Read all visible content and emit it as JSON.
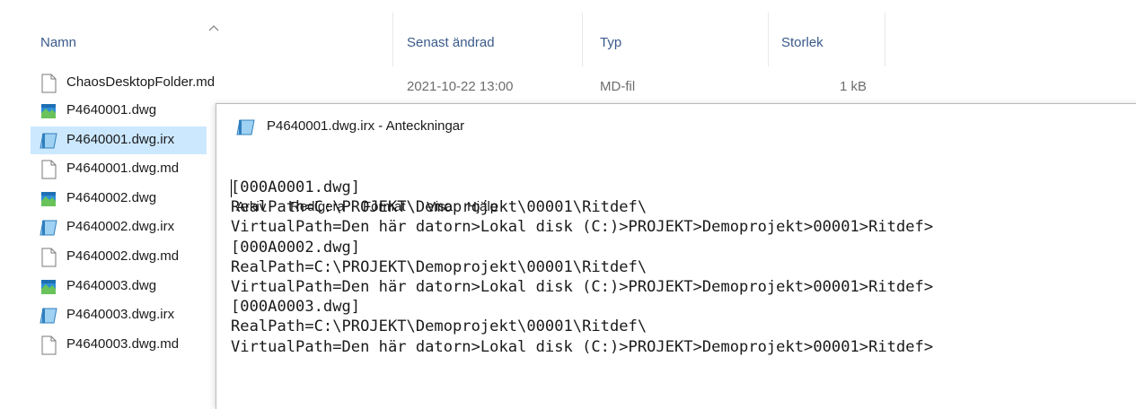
{
  "explorer": {
    "columns": {
      "name": "Namn",
      "modified": "Senast ändrad",
      "type": "Typ",
      "size": "Storlek"
    },
    "first_file": {
      "name": "ChaosDesktopFolder.md",
      "modified": "2021-10-22 13:00",
      "type": "MD-fil",
      "size": "1 kB"
    },
    "files": [
      {
        "name": "P4640001.dwg",
        "icon": "dwg-icon"
      },
      {
        "name": "P4640001.dwg.irx",
        "icon": "notepad-file-icon",
        "selected": true
      },
      {
        "name": "P4640001.dwg.md",
        "icon": "blank-file-icon"
      },
      {
        "name": "P4640002.dwg",
        "icon": "dwg-icon"
      },
      {
        "name": "P4640002.dwg.irx",
        "icon": "notepad-file-icon"
      },
      {
        "name": "P4640002.dwg.md",
        "icon": "blank-file-icon"
      },
      {
        "name": "P4640003.dwg",
        "icon": "dwg-icon"
      },
      {
        "name": "P4640003.dwg.irx",
        "icon": "notepad-file-icon"
      },
      {
        "name": "P4640003.dwg.md",
        "icon": "blank-file-icon"
      }
    ]
  },
  "notepad": {
    "title": "P4640001.dwg.irx - Anteckningar",
    "menu": [
      "Arkiv",
      "Redigera",
      "Format",
      "Visa",
      "Hjälp"
    ],
    "lines": [
      "[000A0001.dwg]",
      "RealPath=C:\\PROJEKT\\Demoprojekt\\00001\\Ritdef\\",
      "VirtualPath=Den här datorn>Lokal disk (C:)>PROJEKT>Demoprojekt>00001>Ritdef>",
      "[000A0002.dwg]",
      "RealPath=C:\\PROJEKT\\Demoprojekt\\00001\\Ritdef\\",
      "VirtualPath=Den här datorn>Lokal disk (C:)>PROJEKT>Demoprojekt>00001>Ritdef>",
      "[000A0003.dwg]",
      "RealPath=C:\\PROJEKT\\Demoprojekt\\00001\\Ritdef\\",
      "VirtualPath=Den här datorn>Lokal disk (C:)>PROJEKT>Demoprojekt>00001>Ritdef>"
    ]
  },
  "colors": {
    "header_text": "#3a5a8a",
    "selection": "#cce8ff",
    "secondary_text": "#6d6d6d"
  }
}
